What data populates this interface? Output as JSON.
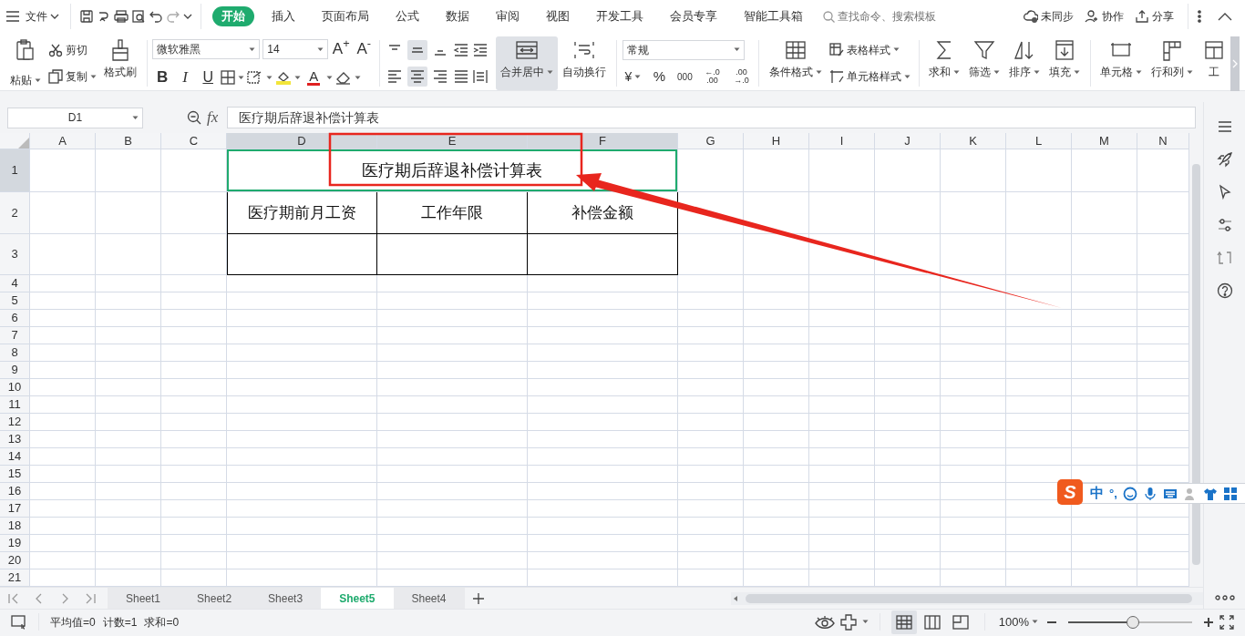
{
  "menu": {
    "file": "文件",
    "tabs": [
      {
        "label": "开始",
        "selected": true
      },
      {
        "label": "插入",
        "selected": false
      },
      {
        "label": "页面布局",
        "selected": false
      },
      {
        "label": "公式",
        "selected": false
      },
      {
        "label": "数据",
        "selected": false
      },
      {
        "label": "审阅",
        "selected": false
      },
      {
        "label": "视图",
        "selected": false
      },
      {
        "label": "开发工具",
        "selected": false
      },
      {
        "label": "会员专享",
        "selected": false
      },
      {
        "label": "智能工具箱",
        "selected": false
      }
    ],
    "search": {
      "placeholder": "查找命令、搜索模板"
    },
    "actions": [
      {
        "kind": "sync",
        "label": "未同步"
      },
      {
        "kind": "collab",
        "label": "协作"
      },
      {
        "kind": "share",
        "label": "分享"
      }
    ]
  },
  "ribbon": {
    "clipboard": {
      "paste": "粘贴",
      "cut": "剪切",
      "copy": "复制",
      "painter": "格式刷"
    },
    "font": {
      "name": "微软雅黑",
      "size": "14",
      "grow": "A$^{+}$",
      "shrink": "A$^{-}$",
      "bold": "B",
      "italic": "I",
      "underline": "U",
      "color_letter": "A"
    },
    "vertical_align": [
      {
        "selected": false
      },
      {
        "selected": true
      },
      {
        "selected": false
      }
    ],
    "horizontal_align": [
      {
        "selected": false
      },
      {
        "selected": true
      },
      {
        "selected": false
      }
    ],
    "merge": {
      "label": "合并居中",
      "selected": true
    },
    "wrap": "自动换行",
    "number": {
      "format": "常规",
      "currency": "¥",
      "percent": "%",
      "thousands": "000",
      "add_decimal": [
        "←.0",
        ".00"
      ],
      "remove_decimal": [
        ".00",
        "→.0"
      ]
    },
    "styles": {
      "conditional": "条件格式",
      "table_style": "表格样式",
      "cell_style": "单元格样式"
    },
    "editing": [
      "求和",
      "筛选",
      "排序",
      "填充"
    ],
    "cells": [
      "单元格",
      "行和列",
      "工"
    ]
  },
  "formula_bar": {
    "name_box": "D1",
    "fx": "fx",
    "value": "医疗期后辞退补偿计算表"
  },
  "sheet": {
    "columns": [
      {
        "label": "A",
        "selected": false
      },
      {
        "label": "B",
        "selected": false
      },
      {
        "label": "C",
        "selected": false
      },
      {
        "label": "D",
        "selected": true
      },
      {
        "label": "E",
        "selected": true
      },
      {
        "label": "F",
        "selected": true
      },
      {
        "label": "G",
        "selected": false
      },
      {
        "label": "H",
        "selected": false
      },
      {
        "label": "I",
        "selected": false
      },
      {
        "label": "J",
        "selected": false
      },
      {
        "label": "K",
        "selected": false
      },
      {
        "label": "L",
        "selected": false
      },
      {
        "label": "M",
        "selected": false
      },
      {
        "label": "N",
        "selected": false
      }
    ],
    "rows": [
      {
        "label": "1",
        "selected": true
      },
      {
        "label": "2",
        "selected": false
      },
      {
        "label": "3",
        "selected": false
      },
      {
        "label": "4",
        "selected": false
      },
      {
        "label": "5",
        "selected": false
      },
      {
        "label": "6",
        "selected": false
      },
      {
        "label": "7",
        "selected": false
      },
      {
        "label": "8",
        "selected": false
      },
      {
        "label": "9",
        "selected": false
      },
      {
        "label": "10",
        "selected": false
      },
      {
        "label": "11",
        "selected": false
      },
      {
        "label": "12",
        "selected": false
      },
      {
        "label": "13",
        "selected": false
      },
      {
        "label": "14",
        "selected": false
      },
      {
        "label": "15",
        "selected": false
      },
      {
        "label": "16",
        "selected": false
      },
      {
        "label": "17",
        "selected": false
      },
      {
        "label": "18",
        "selected": false
      },
      {
        "label": "19",
        "selected": false
      },
      {
        "label": "20",
        "selected": false
      },
      {
        "label": "21",
        "selected": false
      }
    ],
    "title_cell": {
      "text": "医疗期后辞退补偿计算表",
      "selected": true
    },
    "header_cells": [
      "医疗期前月工资",
      "工作年限",
      "补偿金额"
    ]
  },
  "annotations": {
    "highlight_box": true,
    "arrow": true
  },
  "ime": {
    "logo": "S",
    "mode": "中",
    "punct": "°,"
  },
  "sheet_tabs": [
    {
      "label": "Sheet1",
      "selected": false
    },
    {
      "label": "Sheet2",
      "selected": false
    },
    {
      "label": "Sheet3",
      "selected": false
    },
    {
      "label": "Sheet5",
      "selected": true
    },
    {
      "label": "Sheet4",
      "selected": false
    }
  ],
  "status_bar": {
    "stats": [
      "平均值=0",
      "计数=1",
      "求和=0"
    ],
    "views": [
      {
        "selected": true
      },
      {
        "selected": false
      },
      {
        "selected": false
      }
    ],
    "zoom": "100%",
    "zoom_slider": {
      "level": 0.52
    }
  }
}
